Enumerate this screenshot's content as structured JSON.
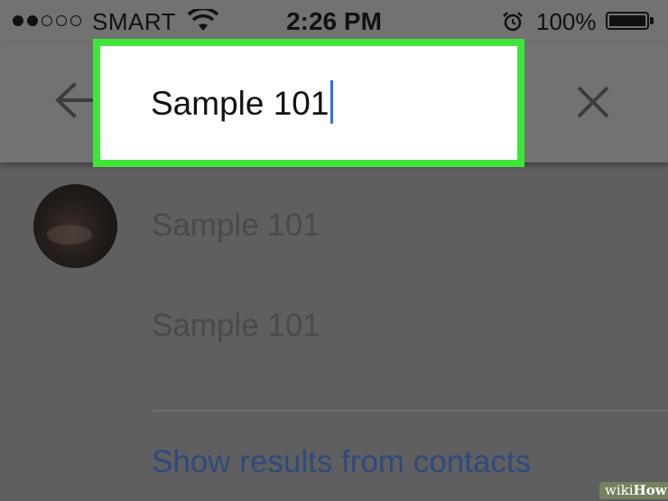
{
  "status_bar": {
    "carrier": "SMART",
    "time": "2:26 PM",
    "battery_percent": "100%",
    "signal_bars_filled": 2,
    "signal_bars_total": 5,
    "battery_level": 1.0
  },
  "search": {
    "value": "Sample 101",
    "back_icon": "back-arrow-icon",
    "clear_icon": "close-icon"
  },
  "suggestions": [
    {
      "label": "Sample 101",
      "has_avatar": true
    },
    {
      "label": "Sample 101",
      "has_avatar": false
    }
  ],
  "contacts_link": "Show results from contacts",
  "watermark": {
    "prefix": "wiki",
    "suffix": "How"
  },
  "colors": {
    "highlight_border": "#3ee63a",
    "cursor": "#2f6fde",
    "link": "#2e4a7e"
  }
}
